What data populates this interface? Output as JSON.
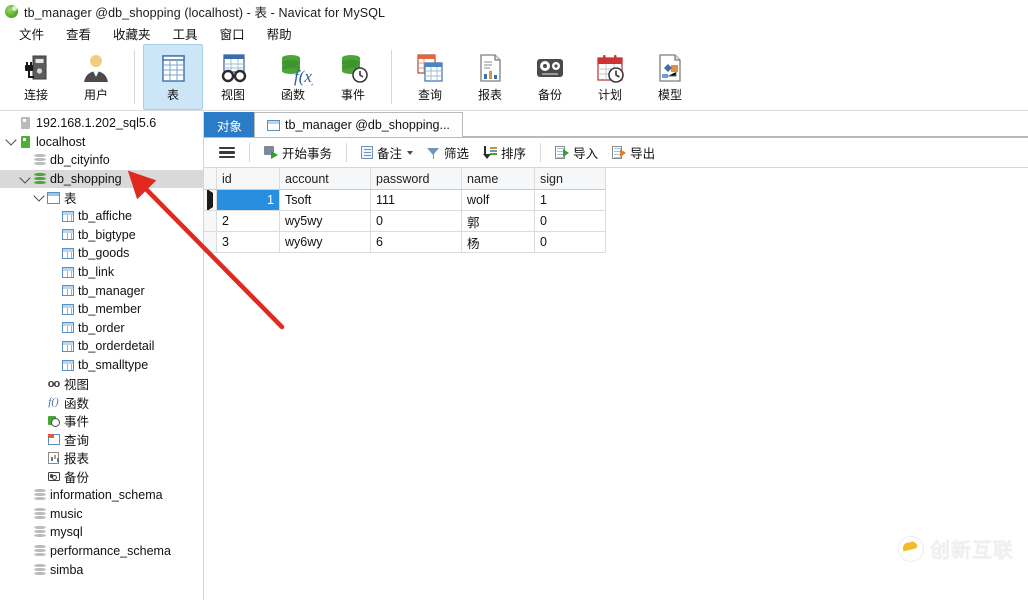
{
  "window": {
    "title": "tb_manager @db_shopping (localhost) - 表 - Navicat for MySQL",
    "app_icon": "navicat-logo-icon"
  },
  "menubar": {
    "items": [
      {
        "label": "文件",
        "name": "menu-file"
      },
      {
        "label": "查看",
        "name": "menu-view"
      },
      {
        "label": "收藏夹",
        "name": "menu-favorites"
      },
      {
        "label": "工具",
        "name": "menu-tools"
      },
      {
        "label": "窗口",
        "name": "menu-window"
      },
      {
        "label": "帮助",
        "name": "menu-help"
      }
    ]
  },
  "toolbar": {
    "groups": [
      [
        {
          "label": "连接",
          "icon": "connection-icon",
          "active": false
        },
        {
          "label": "用户",
          "icon": "user-icon",
          "active": false
        }
      ],
      [
        {
          "label": "表",
          "icon": "table-icon",
          "active": true
        },
        {
          "label": "视图",
          "icon": "view-icon",
          "active": false
        },
        {
          "label": "函数",
          "icon": "function-icon",
          "active": false
        },
        {
          "label": "事件",
          "icon": "event-icon",
          "active": false
        }
      ],
      [
        {
          "label": "查询",
          "icon": "query-icon",
          "active": false
        },
        {
          "label": "报表",
          "icon": "report-icon",
          "active": false
        },
        {
          "label": "备份",
          "icon": "backup-icon",
          "active": false
        },
        {
          "label": "计划",
          "icon": "schedule-icon",
          "active": false
        },
        {
          "label": "模型",
          "icon": "model-icon",
          "active": false
        }
      ]
    ],
    "active_accent": "#cde6f7"
  },
  "sidebar": {
    "nodes": [
      {
        "label": "192.168.1.202_sql5.6",
        "icon": "server-icon",
        "indent": 1,
        "twisty": "",
        "state": "off",
        "selected": false
      },
      {
        "label": "localhost",
        "icon": "server-icon",
        "indent": 1,
        "twisty": "expanded",
        "state": "on",
        "selected": false
      },
      {
        "label": "db_cityinfo",
        "icon": "database-icon",
        "indent": 2,
        "twisty": "",
        "state": "off",
        "selected": false
      },
      {
        "label": "db_shopping",
        "icon": "database-icon",
        "indent": 2,
        "twisty": "expanded",
        "state": "on",
        "selected": true
      },
      {
        "label": "表",
        "icon": "tables-folder-icon",
        "indent": 3,
        "twisty": "expanded",
        "state": "on",
        "selected": false
      },
      {
        "label": "tb_affiche",
        "icon": "table-icon",
        "indent": 4,
        "twisty": "",
        "state": "",
        "selected": false
      },
      {
        "label": "tb_bigtype",
        "icon": "table-icon",
        "indent": 4,
        "twisty": "",
        "state": "",
        "selected": false
      },
      {
        "label": "tb_goods",
        "icon": "table-icon",
        "indent": 4,
        "twisty": "",
        "state": "",
        "selected": false
      },
      {
        "label": "tb_link",
        "icon": "table-icon",
        "indent": 4,
        "twisty": "",
        "state": "",
        "selected": false
      },
      {
        "label": "tb_manager",
        "icon": "table-icon",
        "indent": 4,
        "twisty": "",
        "state": "",
        "selected": false
      },
      {
        "label": "tb_member",
        "icon": "table-icon",
        "indent": 4,
        "twisty": "",
        "state": "",
        "selected": false
      },
      {
        "label": "tb_order",
        "icon": "table-icon",
        "indent": 4,
        "twisty": "",
        "state": "",
        "selected": false
      },
      {
        "label": "tb_orderdetail",
        "icon": "table-icon",
        "indent": 4,
        "twisty": "",
        "state": "",
        "selected": false
      },
      {
        "label": "tb_smalltype",
        "icon": "table-icon",
        "indent": 4,
        "twisty": "",
        "state": "",
        "selected": false
      },
      {
        "label": "视图",
        "icon": "views-icon",
        "indent": 3,
        "twisty": "",
        "state": "",
        "selected": false
      },
      {
        "label": "函数",
        "icon": "functions-icon",
        "indent": 3,
        "twisty": "",
        "state": "",
        "selected": false
      },
      {
        "label": "事件",
        "icon": "events-icon",
        "indent": 3,
        "twisty": "",
        "state": "",
        "selected": false
      },
      {
        "label": "查询",
        "icon": "queries-icon",
        "indent": 3,
        "twisty": "",
        "state": "",
        "selected": false
      },
      {
        "label": "报表",
        "icon": "reports-icon",
        "indent": 3,
        "twisty": "",
        "state": "",
        "selected": false
      },
      {
        "label": "备份",
        "icon": "backups-icon",
        "indent": 3,
        "twisty": "",
        "state": "",
        "selected": false
      },
      {
        "label": "information_schema",
        "icon": "database-icon",
        "indent": 2,
        "twisty": "",
        "state": "off",
        "selected": false
      },
      {
        "label": "music",
        "icon": "database-icon",
        "indent": 2,
        "twisty": "",
        "state": "off",
        "selected": false
      },
      {
        "label": "mysql",
        "icon": "database-icon",
        "indent": 2,
        "twisty": "",
        "state": "off",
        "selected": false
      },
      {
        "label": "performance_schema",
        "icon": "database-icon",
        "indent": 2,
        "twisty": "",
        "state": "off",
        "selected": false
      },
      {
        "label": "simba",
        "icon": "database-icon",
        "indent": 2,
        "twisty": "",
        "state": "off",
        "selected": false
      }
    ]
  },
  "tabs": {
    "items": [
      {
        "label": "对象",
        "name": "tab-objects",
        "active": true,
        "has_icon": false
      },
      {
        "label": "tb_manager @db_shopping...",
        "name": "tab-tb-manager",
        "active": false,
        "has_icon": true
      }
    ],
    "active_color": "#2a7cc7"
  },
  "grid_toolbar": {
    "menu_icon": "hamburger-icon",
    "buttons": [
      {
        "label": "开始事务",
        "icon": "begin-transaction-icon",
        "dropdown": false,
        "name": "begin-transaction-button"
      },
      {
        "label": "备注",
        "icon": "note-icon",
        "dropdown": true,
        "name": "note-button"
      },
      {
        "label": "筛选",
        "icon": "filter-icon",
        "dropdown": false,
        "name": "filter-button"
      },
      {
        "label": "排序",
        "icon": "sort-icon",
        "dropdown": false,
        "name": "sort-button"
      },
      {
        "label": "导入",
        "icon": "import-icon",
        "dropdown": false,
        "name": "import-button"
      },
      {
        "label": "导出",
        "icon": "export-icon",
        "dropdown": false,
        "name": "export-button"
      }
    ]
  },
  "grid": {
    "columns": [
      "id",
      "account",
      "password",
      "name",
      "sign"
    ],
    "rows": [
      {
        "cells": [
          "1",
          "Tsoft",
          "111",
          "wolf",
          "1"
        ],
        "selected": true,
        "indicator": true
      },
      {
        "cells": [
          "2",
          "wy5wy",
          "0",
          "郭",
          "0"
        ],
        "selected": false,
        "indicator": false
      },
      {
        "cells": [
          "3",
          "wy6wy",
          "6",
          "杨",
          "0"
        ],
        "selected": false,
        "indicator": false
      }
    ],
    "selected_cell_color": "#2a8ede"
  },
  "annotation": {
    "arrow_color": "#e02a20",
    "points_at": "db_shopping"
  },
  "watermark": {
    "text": "创新互联",
    "logo": "chuangxin-logo-icon"
  }
}
